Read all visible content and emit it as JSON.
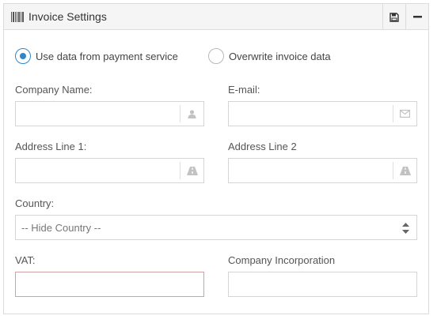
{
  "panel": {
    "title": "Invoice Settings",
    "icons": {
      "title": "barcode-icon",
      "save": "floppy-disk-icon",
      "minimize": "minus-icon"
    }
  },
  "source": {
    "options": [
      {
        "label": "Use data from payment service",
        "checked": true
      },
      {
        "label": "Overwrite invoice data",
        "checked": false
      }
    ]
  },
  "fields": {
    "company_name": {
      "label": "Company Name:",
      "value": "",
      "icon": "user-icon"
    },
    "email": {
      "label": "E-mail:",
      "value": "",
      "icon": "envelope-icon"
    },
    "address1": {
      "label": "Address Line 1:",
      "value": "",
      "icon": "road-icon"
    },
    "address2": {
      "label": "Address Line 2",
      "value": "",
      "icon": "road-icon"
    },
    "country": {
      "label": "Country:",
      "selected": "-- Hide Country --",
      "icon": "sort-arrows-icon"
    },
    "vat": {
      "label": "VAT:",
      "value": ""
    },
    "company_incorporation": {
      "label": "Company Incorporation",
      "value": ""
    }
  },
  "colors": {
    "accent": "#2f87c9",
    "error_border": "#d4a0a0",
    "border": "#d5d5d5",
    "header_bg": "#f5f5f5"
  }
}
